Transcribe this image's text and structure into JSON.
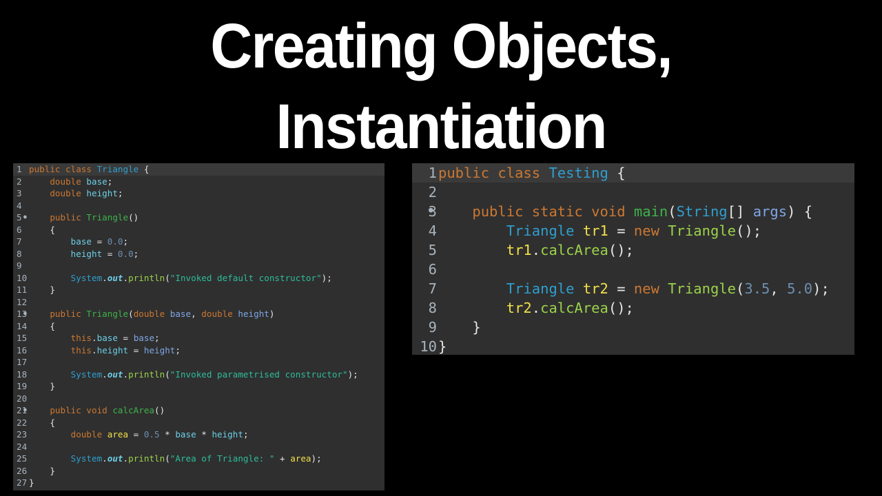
{
  "title": {
    "line1": "Creating Objects,",
    "line2": "Instantiation"
  },
  "left_editor": {
    "file_class": "Triangle",
    "lines": [
      {
        "num": "1",
        "marker": "",
        "tokens": [
          [
            "k",
            "public class "
          ],
          [
            "t",
            "Triangle"
          ],
          [
            "o",
            " {"
          ]
        ]
      },
      {
        "num": "2",
        "marker": "",
        "tokens": [
          [
            "o",
            "    "
          ],
          [
            "k",
            "double "
          ],
          [
            "f",
            "base"
          ],
          [
            "o",
            ";"
          ]
        ]
      },
      {
        "num": "3",
        "marker": "",
        "tokens": [
          [
            "o",
            "    "
          ],
          [
            "k",
            "double "
          ],
          [
            "f",
            "height"
          ],
          [
            "o",
            ";"
          ]
        ]
      },
      {
        "num": "4",
        "marker": "",
        "tokens": []
      },
      {
        "num": "5",
        "marker": "●",
        "tokens": [
          [
            "o",
            "    "
          ],
          [
            "k",
            "public "
          ],
          [
            "m",
            "Triangle"
          ],
          [
            "o",
            "()"
          ]
        ]
      },
      {
        "num": "6",
        "marker": "",
        "tokens": [
          [
            "o",
            "    {"
          ]
        ]
      },
      {
        "num": "7",
        "marker": "",
        "tokens": [
          [
            "o",
            "        "
          ],
          [
            "f",
            "base"
          ],
          [
            "o",
            " = "
          ],
          [
            "n",
            "0.0"
          ],
          [
            "o",
            ";"
          ]
        ]
      },
      {
        "num": "8",
        "marker": "",
        "tokens": [
          [
            "o",
            "        "
          ],
          [
            "f",
            "height"
          ],
          [
            "o",
            " = "
          ],
          [
            "n",
            "0.0"
          ],
          [
            "o",
            ";"
          ]
        ]
      },
      {
        "num": "9",
        "marker": "",
        "tokens": []
      },
      {
        "num": "10",
        "marker": "",
        "tokens": [
          [
            "o",
            "        "
          ],
          [
            "sys",
            "System"
          ],
          [
            "o",
            "."
          ],
          [
            "out",
            "out"
          ],
          [
            "o",
            "."
          ],
          [
            "call",
            "println"
          ],
          [
            "o",
            "("
          ],
          [
            "s",
            "\"Invoked default constructor\""
          ],
          [
            "o",
            ");"
          ]
        ]
      },
      {
        "num": "11",
        "marker": "",
        "tokens": [
          [
            "o",
            "    }"
          ]
        ]
      },
      {
        "num": "12",
        "marker": "",
        "tokens": []
      },
      {
        "num": "13",
        "marker": "●",
        "tokens": [
          [
            "o",
            "    "
          ],
          [
            "k",
            "public "
          ],
          [
            "m",
            "Triangle"
          ],
          [
            "o",
            "("
          ],
          [
            "k",
            "double "
          ],
          [
            "p",
            "base"
          ],
          [
            "o",
            ", "
          ],
          [
            "k",
            "double "
          ],
          [
            "p",
            "height"
          ],
          [
            "o",
            ")"
          ]
        ]
      },
      {
        "num": "14",
        "marker": "",
        "tokens": [
          [
            "o",
            "    {"
          ]
        ]
      },
      {
        "num": "15",
        "marker": "",
        "tokens": [
          [
            "o",
            "        "
          ],
          [
            "k",
            "this"
          ],
          [
            "o",
            "."
          ],
          [
            "f",
            "base"
          ],
          [
            "o",
            " = "
          ],
          [
            "p",
            "base"
          ],
          [
            "o",
            ";"
          ]
        ]
      },
      {
        "num": "16",
        "marker": "",
        "tokens": [
          [
            "o",
            "        "
          ],
          [
            "k",
            "this"
          ],
          [
            "o",
            "."
          ],
          [
            "f",
            "height"
          ],
          [
            "o",
            " = "
          ],
          [
            "p",
            "height"
          ],
          [
            "o",
            ";"
          ]
        ]
      },
      {
        "num": "17",
        "marker": "",
        "tokens": []
      },
      {
        "num": "18",
        "marker": "",
        "tokens": [
          [
            "o",
            "        "
          ],
          [
            "sys",
            "System"
          ],
          [
            "o",
            "."
          ],
          [
            "out",
            "out"
          ],
          [
            "o",
            "."
          ],
          [
            "call",
            "println"
          ],
          [
            "o",
            "("
          ],
          [
            "s",
            "\"Invoked parametrised constructor\""
          ],
          [
            "o",
            ");"
          ]
        ]
      },
      {
        "num": "19",
        "marker": "",
        "tokens": [
          [
            "o",
            "    }"
          ]
        ]
      },
      {
        "num": "20",
        "marker": "",
        "tokens": []
      },
      {
        "num": "21",
        "marker": "●",
        "tokens": [
          [
            "o",
            "    "
          ],
          [
            "k",
            "public void "
          ],
          [
            "m",
            "calcArea"
          ],
          [
            "o",
            "()"
          ]
        ]
      },
      {
        "num": "22",
        "marker": "",
        "tokens": [
          [
            "o",
            "    {"
          ]
        ]
      },
      {
        "num": "23",
        "marker": "",
        "tokens": [
          [
            "o",
            "        "
          ],
          [
            "k",
            "double "
          ],
          [
            "v",
            "area"
          ],
          [
            "o",
            " = "
          ],
          [
            "n",
            "0.5"
          ],
          [
            "o",
            " * "
          ],
          [
            "f",
            "base"
          ],
          [
            "o",
            " * "
          ],
          [
            "f",
            "height"
          ],
          [
            "o",
            ";"
          ]
        ]
      },
      {
        "num": "24",
        "marker": "",
        "tokens": []
      },
      {
        "num": "25",
        "marker": "",
        "tokens": [
          [
            "o",
            "        "
          ],
          [
            "sys",
            "System"
          ],
          [
            "o",
            "."
          ],
          [
            "out",
            "out"
          ],
          [
            "o",
            "."
          ],
          [
            "call",
            "println"
          ],
          [
            "o",
            "("
          ],
          [
            "s",
            "\"Area of Triangle: \""
          ],
          [
            "o",
            " + "
          ],
          [
            "v",
            "area"
          ],
          [
            "o",
            ");"
          ]
        ]
      },
      {
        "num": "26",
        "marker": "",
        "tokens": [
          [
            "o",
            "    }"
          ]
        ]
      },
      {
        "num": "27",
        "marker": "",
        "tokens": [
          [
            "o",
            "}"
          ]
        ]
      }
    ]
  },
  "right_editor": {
    "file_class": "Testing",
    "lines": [
      {
        "num": "1",
        "marker": "",
        "tokens": [
          [
            "k",
            "public class "
          ],
          [
            "t",
            "Testing"
          ],
          [
            "o",
            " {"
          ]
        ]
      },
      {
        "num": "2",
        "marker": "",
        "tokens": []
      },
      {
        "num": "3",
        "marker": "●",
        "tokens": [
          [
            "o",
            "    "
          ],
          [
            "k",
            "public static void "
          ],
          [
            "m",
            "main"
          ],
          [
            "o",
            "("
          ],
          [
            "t",
            "String"
          ],
          [
            "o",
            "[] "
          ],
          [
            "p",
            "args"
          ],
          [
            "o",
            ") {"
          ]
        ]
      },
      {
        "num": "4",
        "marker": "",
        "tokens": [
          [
            "o",
            "        "
          ],
          [
            "t",
            "Triangle "
          ],
          [
            "v",
            "tr1"
          ],
          [
            "o",
            " = "
          ],
          [
            "k",
            "new "
          ],
          [
            "ml",
            "Triangle"
          ],
          [
            "o",
            "();"
          ]
        ]
      },
      {
        "num": "5",
        "marker": "",
        "tokens": [
          [
            "o",
            "        "
          ],
          [
            "v",
            "tr1"
          ],
          [
            "o",
            "."
          ],
          [
            "ml",
            "calcArea"
          ],
          [
            "o",
            "();"
          ]
        ]
      },
      {
        "num": "6",
        "marker": "",
        "tokens": []
      },
      {
        "num": "7",
        "marker": "",
        "tokens": [
          [
            "o",
            "        "
          ],
          [
            "t",
            "Triangle "
          ],
          [
            "v",
            "tr2"
          ],
          [
            "o",
            " = "
          ],
          [
            "k",
            "new "
          ],
          [
            "ml",
            "Triangle"
          ],
          [
            "o",
            "("
          ],
          [
            "n",
            "3.5"
          ],
          [
            "o",
            ", "
          ],
          [
            "n",
            "5.0"
          ],
          [
            "o",
            ");"
          ]
        ]
      },
      {
        "num": "8",
        "marker": "",
        "tokens": [
          [
            "o",
            "        "
          ],
          [
            "v",
            "tr2"
          ],
          [
            "o",
            "."
          ],
          [
            "ml",
            "calcArea"
          ],
          [
            "o",
            "();"
          ]
        ]
      },
      {
        "num": "9",
        "marker": "",
        "tokens": [
          [
            "o",
            "    }"
          ]
        ]
      },
      {
        "num": "10",
        "marker": "",
        "tokens": [
          [
            "o",
            "}"
          ]
        ]
      }
    ]
  }
}
